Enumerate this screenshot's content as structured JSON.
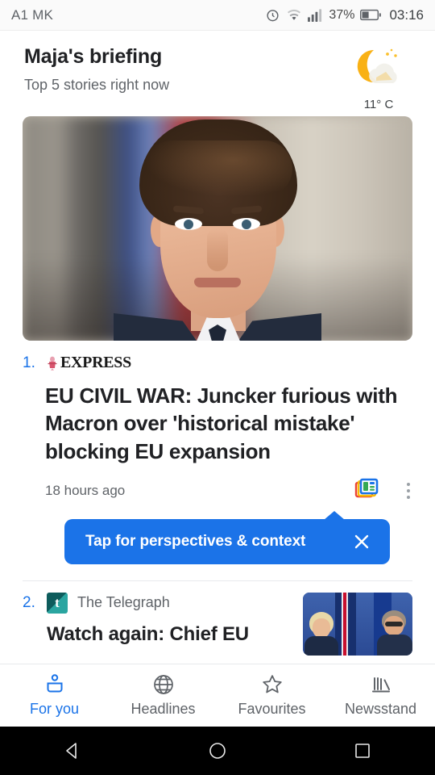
{
  "status_bar": {
    "carrier": "A1 MK",
    "battery_percent": "37%",
    "clock": "03:16",
    "icons": [
      "alarm-icon",
      "wifi-icon",
      "signal-icon",
      "battery-icon"
    ]
  },
  "header": {
    "title": "Maja's briefing",
    "subtitle": "Top 5 stories right now",
    "weather": {
      "icon": "moon-cloud-icon",
      "temperature": "11° C"
    }
  },
  "stories": [
    {
      "rank": "1.",
      "source": "EXPRESS",
      "source_logo": "express-crest-icon",
      "headline": "EU CIVIL WAR: Juncker furious with Macron over 'historical mistake' blocking EU expansion",
      "timestamp": "18 hours ago",
      "hero_image": "emmanuel-macron-portrait",
      "full_coverage_icon": "full-coverage-icon",
      "overflow_icon": "more-options-icon"
    },
    {
      "rank": "2.",
      "source": "The Telegraph",
      "source_logo": "telegraph-logo-icon",
      "headline": "Watch again: Chief EU",
      "thumbnail": "boris-johnson-eu-flags-thumbnail"
    }
  ],
  "tooltip": {
    "text": "Tap for perspectives & context",
    "close_icon": "close-icon",
    "color": "#1b73e8"
  },
  "bottom_nav": {
    "active": "For you",
    "items": [
      {
        "label": "For you",
        "icon": "person-briefcase-icon"
      },
      {
        "label": "Headlines",
        "icon": "globe-icon"
      },
      {
        "label": "Favourites",
        "icon": "star-icon"
      },
      {
        "label": "Newsstand",
        "icon": "newsstand-icon"
      }
    ]
  },
  "android_nav": {
    "back": "back-triangle-icon",
    "home": "home-circle-icon",
    "recents": "recents-square-icon"
  },
  "colors": {
    "accent": "#1a73e8",
    "text_primary": "#202124",
    "text_secondary": "#5f6368"
  }
}
